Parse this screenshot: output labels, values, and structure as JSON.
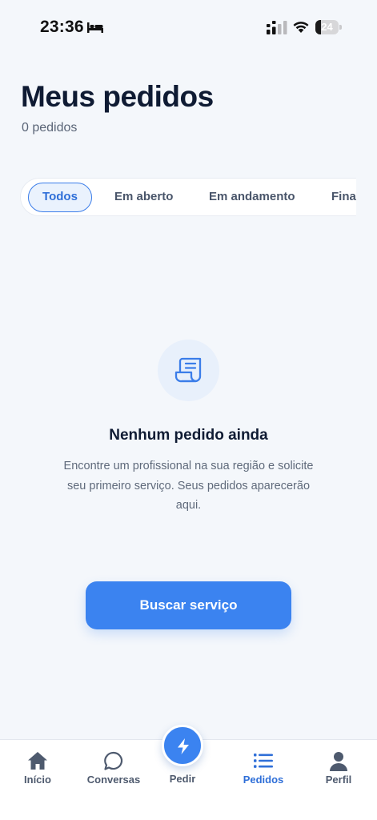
{
  "status_bar": {
    "time": "23:36",
    "battery_level": "24",
    "battery_fraction": 0.24
  },
  "header": {
    "title": "Meus pedidos",
    "subtitle": "0 pedidos"
  },
  "tabs": [
    {
      "label": "Todos",
      "active": true
    },
    {
      "label": "Em aberto",
      "active": false
    },
    {
      "label": "Em andamento",
      "active": false
    },
    {
      "label": "Fina",
      "active": false
    }
  ],
  "empty_state": {
    "icon": "receipt-icon",
    "title": "Nenhum pedido ainda",
    "description": "Encontre um profissional na sua região e solicite seu primeiro serviço. Seus pedidos aparecerão aqui."
  },
  "cta": {
    "label": "Buscar serviço"
  },
  "bottom_nav": {
    "items": [
      {
        "label": "Início",
        "icon": "home-icon"
      },
      {
        "label": "Conversas",
        "icon": "chat-icon"
      },
      {
        "label": "Pedir",
        "icon": "bolt-icon"
      },
      {
        "label": "Pedidos",
        "icon": "list-icon",
        "active": true
      },
      {
        "label": "Perfil",
        "icon": "user-icon"
      }
    ]
  },
  "colors": {
    "accent": "#3b83f0",
    "background": "#f4f7fb",
    "title": "#0f1b33"
  }
}
